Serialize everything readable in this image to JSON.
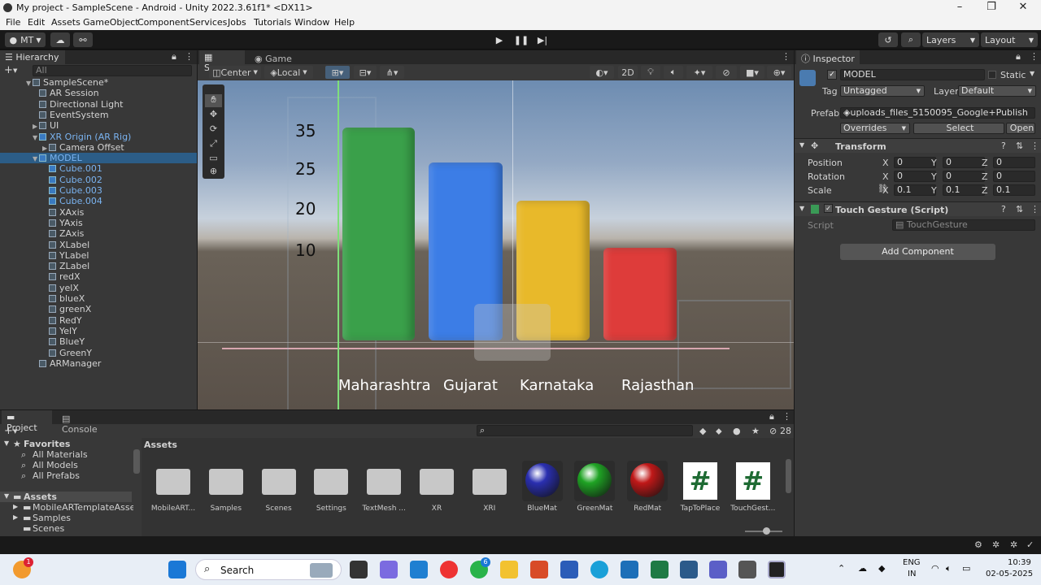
{
  "window": {
    "title": "My project - SampleScene - Android - Unity 2022.3.61f1* <DX11>"
  },
  "menu": [
    "File",
    "Edit",
    "Assets",
    "GameObject",
    "Component",
    "Services",
    "Jobs",
    "Tutorials",
    "Window",
    "Help"
  ],
  "toolbar": {
    "account": "MT",
    "layers": "Layers",
    "layout": "Layout"
  },
  "hierarchy": {
    "tab": "Hierarchy",
    "search_placeholder": "All",
    "items": [
      {
        "label": "SampleScene*",
        "indent": 0
      },
      {
        "label": "AR Session",
        "indent": 1
      },
      {
        "label": "Directional Light",
        "indent": 1
      },
      {
        "label": "EventSystem",
        "indent": 1
      },
      {
        "label": "UI",
        "indent": 1
      },
      {
        "label": "XR Origin (AR Rig)",
        "indent": 1
      },
      {
        "label": "Camera Offset",
        "indent": 2
      },
      {
        "label": "MODEL",
        "indent": 1
      },
      {
        "label": "Cube.001",
        "indent": 2
      },
      {
        "label": "Cube.002",
        "indent": 2
      },
      {
        "label": "Cube.003",
        "indent": 2
      },
      {
        "label": "Cube.004",
        "indent": 2
      },
      {
        "label": "XAxis",
        "indent": 2
      },
      {
        "label": "YAxis",
        "indent": 2
      },
      {
        "label": "ZAxis",
        "indent": 2
      },
      {
        "label": "XLabel",
        "indent": 2
      },
      {
        "label": "YLabel",
        "indent": 2
      },
      {
        "label": "ZLabel",
        "indent": 2
      },
      {
        "label": "redX",
        "indent": 2
      },
      {
        "label": "yelX",
        "indent": 2
      },
      {
        "label": "blueX",
        "indent": 2
      },
      {
        "label": "greenX",
        "indent": 2
      },
      {
        "label": "RedY",
        "indent": 2
      },
      {
        "label": "YelY",
        "indent": 2
      },
      {
        "label": "BlueY",
        "indent": 2
      },
      {
        "label": "GreenY",
        "indent": 2
      },
      {
        "label": "ARManager",
        "indent": 1
      }
    ]
  },
  "scene": {
    "tabs": [
      "Scene",
      "Game"
    ],
    "pivot": "Center",
    "space": "Local",
    "mode_2d": "2D",
    "y_ticks": [
      "35",
      "25",
      "20",
      "10"
    ],
    "bars": [
      {
        "label": "Maharashtra",
        "color": "#3aa04a"
      },
      {
        "label": "Gujarat",
        "color": "#3c7de6"
      },
      {
        "label": "Karnataka",
        "color": "#e8b92a"
      },
      {
        "label": "Rajasthan",
        "color": "#de3c3a"
      }
    ]
  },
  "inspector": {
    "tab": "Inspector",
    "object_name": "MODEL",
    "static_label": "Static",
    "tag_label": "Tag",
    "tag_value": "Untagged",
    "layer_label": "Layer",
    "layer_value": "Default",
    "prefab_label": "Prefab",
    "prefab_value": "uploads_files_5150095_Google+Publish",
    "overrides": "Overrides",
    "select": "Select",
    "open": "Open",
    "transform": {
      "title": "Transform",
      "position_label": "Position",
      "rotation_label": "Rotation",
      "scale_label": "Scale",
      "position": {
        "x": "0",
        "y": "0",
        "z": "0"
      },
      "rotation": {
        "x": "0",
        "y": "0",
        "z": "0"
      },
      "scale": {
        "x": "0.1",
        "y": "0.1",
        "z": "0.1"
      }
    },
    "script_component": {
      "title": "Touch Gesture (Script)",
      "script_label": "Script",
      "script_value": "TouchGesture"
    },
    "add_component": "Add Component"
  },
  "project": {
    "tabs": [
      "Project",
      "Console"
    ],
    "count": "28",
    "favorites_label": "Favorites",
    "favorites": [
      "All Materials",
      "All Models",
      "All Prefabs"
    ],
    "assets_label": "Assets",
    "assets_tree": [
      "MobileARTemplateAssets",
      "Samples",
      "Scenes"
    ],
    "breadcrumb": "Assets",
    "assets": [
      {
        "label": "MobileART...",
        "kind": "folder"
      },
      {
        "label": "Samples",
        "kind": "folder"
      },
      {
        "label": "Scenes",
        "kind": "folder"
      },
      {
        "label": "Settings",
        "kind": "folder"
      },
      {
        "label": "TextMesh ...",
        "kind": "folder"
      },
      {
        "label": "XR",
        "kind": "folder"
      },
      {
        "label": "XRI",
        "kind": "folder"
      },
      {
        "label": "BlueMat",
        "kind": "material",
        "color": "#2a2fb0"
      },
      {
        "label": "GreenMat",
        "kind": "material",
        "color": "#1fa324"
      },
      {
        "label": "RedMat",
        "kind": "material",
        "color": "#c01818"
      },
      {
        "label": "TapToPlace",
        "kind": "script"
      },
      {
        "label": "TouchGest...",
        "kind": "script"
      }
    ]
  },
  "taskbar": {
    "search": "Search",
    "lang1": "ENG",
    "lang2": "IN",
    "time": "10:39",
    "date": "02-05-2025",
    "notif_badge": "1",
    "whatsapp_badge": "6"
  }
}
